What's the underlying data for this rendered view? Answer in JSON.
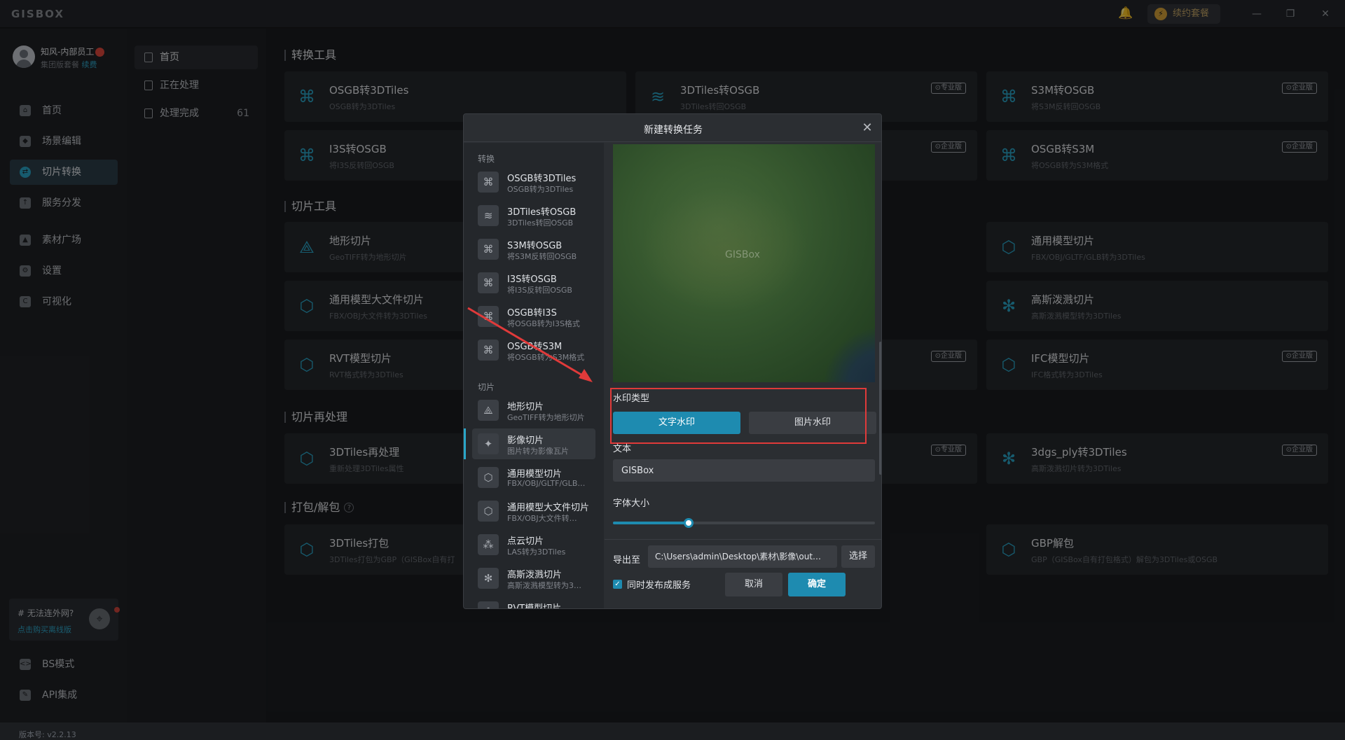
{
  "app": {
    "logo": "GISBOX",
    "renew_label": "续约套餐",
    "minimize": "—",
    "restore": "❐",
    "close": "✕"
  },
  "user": {
    "name": "知风-内部员工",
    "plan": "集团版套餐",
    "renew_link": "续费"
  },
  "sidebar": {
    "items": [
      {
        "label": "首页",
        "icon": "home-icon"
      },
      {
        "label": "场景编辑",
        "icon": "cube-icon"
      },
      {
        "label": "切片转换",
        "icon": "convert-icon"
      },
      {
        "label": "服务分发",
        "icon": "upload-icon"
      },
      {
        "label": "素材广场",
        "icon": "chart-icon"
      },
      {
        "label": "设置",
        "icon": "gear-icon"
      },
      {
        "label": "可视化",
        "icon": "c-icon"
      },
      {
        "label": "BS模式",
        "icon": "code-icon"
      },
      {
        "label": "API集成",
        "icon": "api-icon"
      }
    ],
    "active_index": 2,
    "promo_title": "# 无法连外网?",
    "promo_link": "点击购买离线版",
    "version": "版本号: v2.2.13"
  },
  "subnav": {
    "items": [
      {
        "label": "首页",
        "count": ""
      },
      {
        "label": "正在处理",
        "count": ""
      },
      {
        "label": "处理完成",
        "count": "61"
      }
    ]
  },
  "main": {
    "sections": [
      {
        "title": "转换工具"
      },
      {
        "title": "切片工具"
      },
      {
        "title": "切片再处理"
      },
      {
        "title": "打包/解包"
      }
    ],
    "cards": [
      {
        "title": "OSGB转3DTiles",
        "sub": "OSGB转为3DTiles",
        "tag": ""
      },
      {
        "title": "3DTiles转OSGB",
        "sub": "3DTiles转回OSGB",
        "tag": "⊙专业版"
      },
      {
        "title": "S3M转OSGB",
        "sub": "将S3M反转回OSGB",
        "tag": "⊙企业版"
      },
      {
        "title": "I3S转OSGB",
        "sub": "将I3S反转回OSGB",
        "tag": ""
      },
      {
        "title": "",
        "sub": "",
        "tag": "⊙企业版"
      },
      {
        "title": "OSGB转S3M",
        "sub": "将OSGB转为S3M格式",
        "tag": "⊙企业版"
      },
      {
        "title": "地形切片",
        "sub": "GeoTIFF转为地形切片",
        "tag": ""
      },
      {
        "title": "通用模型切片",
        "sub": "FBX/OBJ/GLTF/GLB转为3DTiles",
        "tag": ""
      },
      {
        "title": "通用模型大文件切片",
        "sub": "FBX/OBJ大文件转为3DTiles",
        "tag": ""
      },
      {
        "title": "高斯泼溅切片",
        "sub": "高斯泼溅模型转为3DTiles",
        "tag": ""
      },
      {
        "title": "RVT模型切片",
        "sub": "RVT格式转为3DTiles",
        "tag": ""
      },
      {
        "title": "",
        "sub": "",
        "tag": "⊙企业版"
      },
      {
        "title": "IFC模型切片",
        "sub": "IFC格式转为3DTiles",
        "tag": "⊙企业版"
      },
      {
        "title": "3DTiles再处理",
        "sub": "重新处理3DTiles属性",
        "tag": ""
      },
      {
        "title": "",
        "sub": "",
        "tag": "⊙专业版"
      },
      {
        "title": "3dgs_ply转3DTiles",
        "sub": "高斯泼溅切片转为3DTiles",
        "tag": "⊙企业版"
      },
      {
        "title": "3DTiles打包",
        "sub": "3DTiles打包为GBP（GISBox自有打",
        "tag": ""
      },
      {
        "title": "GBP解包",
        "sub": "GBP（GISBox自有打包格式）解包为3DTiles或OSGB",
        "tag": ""
      }
    ]
  },
  "dialog": {
    "title": "新建转换任务",
    "close": "✕",
    "group_convert": "转换",
    "group_slice": "切片",
    "tools": [
      {
        "name": "OSGB转3DTiles",
        "desc": "OSGB转为3DTiles"
      },
      {
        "name": "3DTiles转OSGB",
        "desc": "3DTiles转回OSGB"
      },
      {
        "name": "S3M转OSGB",
        "desc": "将S3M反转回OSGB"
      },
      {
        "name": "I3S转OSGB",
        "desc": "将I3S反转回OSGB"
      },
      {
        "name": "OSGB转I3S",
        "desc": "将OSGB转为I3S格式"
      },
      {
        "name": "OSGB转S3M",
        "desc": "将OSGB转为S3M格式"
      },
      {
        "name": "地形切片",
        "desc": "GeoTIFF转为地形切片"
      },
      {
        "name": "影像切片",
        "desc": "图片转为影像瓦片"
      },
      {
        "name": "通用模型切片",
        "desc": "FBX/OBJ/GLTF/GLB…"
      },
      {
        "name": "通用模型大文件切片",
        "desc": "FBX/OBJ大文件转…"
      },
      {
        "name": "点云切片",
        "desc": "LAS转为3DTiles"
      },
      {
        "name": "高斯泼溅切片",
        "desc": "高斯泼溅模型转为3…"
      },
      {
        "name": "RVT模型切片",
        "desc": ""
      }
    ],
    "active_tool": 7,
    "preview_watermark": "GISBox",
    "watermark_type_label": "水印类型",
    "text_watermark": "文字水印",
    "image_watermark": "图片水印",
    "text_label": "文本",
    "text_value": "GISBox",
    "font_size_label": "字体大小",
    "font_size_level": 0.29,
    "export_label": "导出至",
    "export_path": "C:\\Users\\admin\\Desktop\\素材\\影像\\out…",
    "select_button": "选择",
    "publish_checkbox": "同时发布成服务",
    "publish_checked": true,
    "cancel": "取消",
    "ok": "确定"
  },
  "colors": {
    "accent": "#1e8bb0",
    "highlight_box": "#e03a3a"
  }
}
